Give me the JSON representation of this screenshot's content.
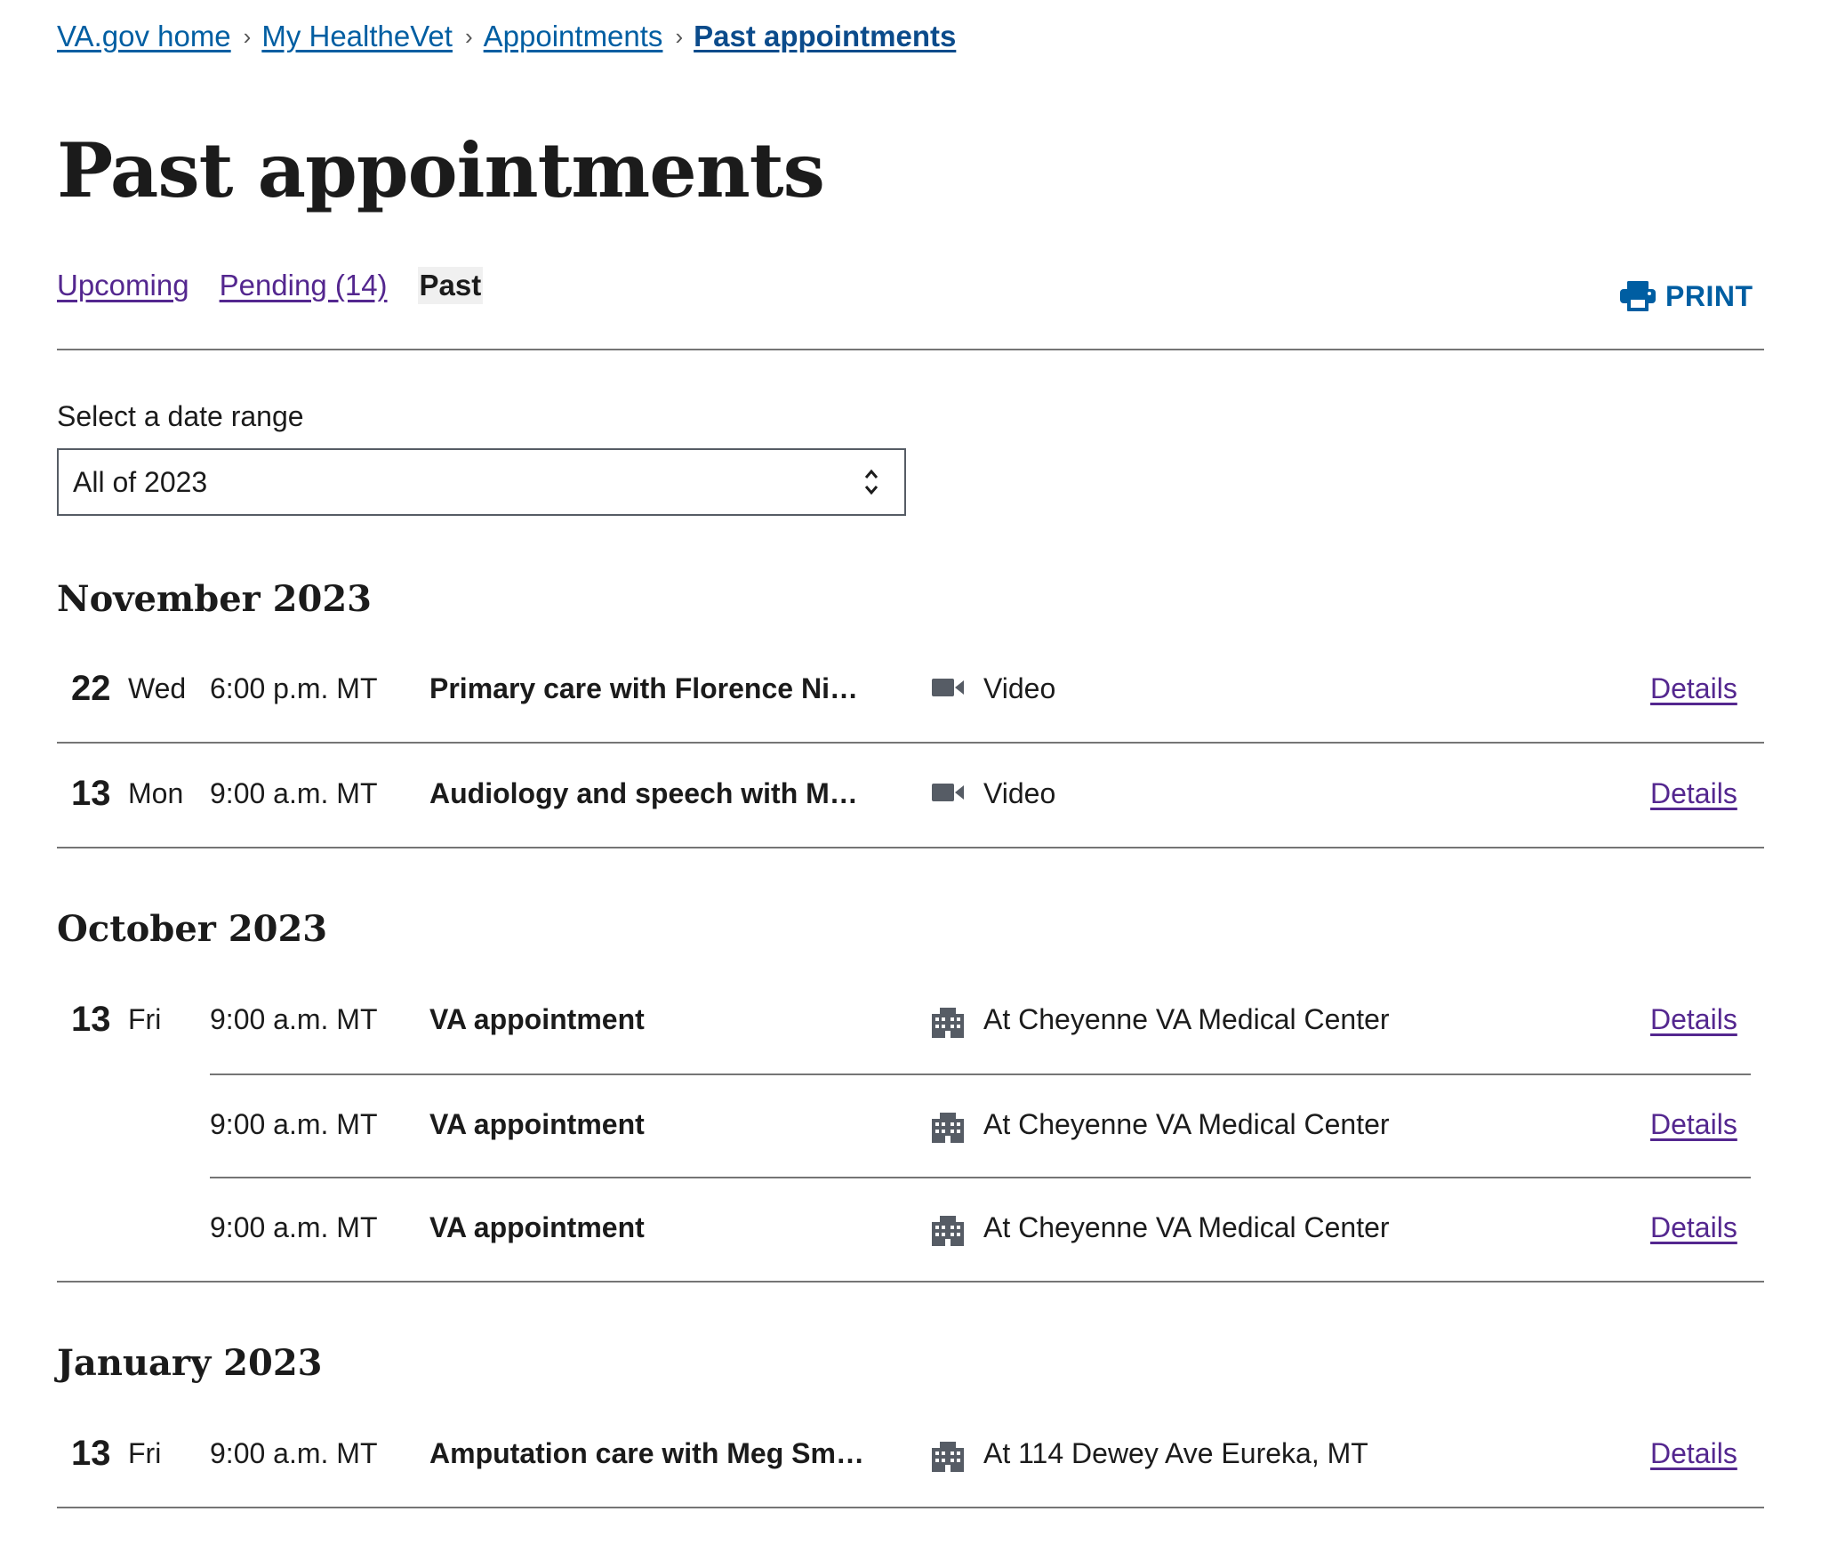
{
  "breadcrumb": {
    "items": [
      "VA.gov home",
      "My HealtheVet",
      "Appointments"
    ],
    "current": "Past appointments"
  },
  "page_title": "Past appointments",
  "tabs": {
    "upcoming": "Upcoming",
    "pending": "Pending (14)",
    "past": "Past"
  },
  "print_label": "PRINT",
  "date_range": {
    "label": "Select a date range",
    "selected": "All of 2023"
  },
  "months": [
    {
      "heading": "November 2023",
      "appointments": [
        {
          "day": "22",
          "weekday": "Wed",
          "time": "6:00 p.m. MT",
          "title": "Primary care with Florence Nig...",
          "icon": "video-camera-icon",
          "location": "Video",
          "details": "Details"
        },
        {
          "day": "13",
          "weekday": "Mon",
          "time": "9:00 a.m. MT",
          "title": "Audiology and speech with Meg...",
          "icon": "video-camera-icon",
          "location": "Video",
          "details": "Details"
        }
      ]
    },
    {
      "heading": "October 2023",
      "appointments": [
        {
          "day": "13",
          "weekday": "Fri",
          "time": "9:00 a.m. MT",
          "title": "VA appointment",
          "icon": "building-icon",
          "location": "At Cheyenne VA Medical Center",
          "details": "Details"
        },
        {
          "day": "",
          "weekday": "",
          "time": "9:00 a.m. MT",
          "title": "VA appointment",
          "icon": "building-icon",
          "location": "At Cheyenne VA Medical Center",
          "details": "Details"
        },
        {
          "day": "",
          "weekday": "",
          "time": "9:00 a.m. MT",
          "title": "VA appointment",
          "icon": "building-icon",
          "location": "At Cheyenne VA Medical Center",
          "details": "Details"
        }
      ]
    },
    {
      "heading": "January 2023",
      "appointments": [
        {
          "day": "13",
          "weekday": "Fri",
          "time": "9:00 a.m. MT",
          "title": "Amputation care with Meg Smith",
          "icon": "building-icon",
          "location": "At 114 Dewey Ave Eureka, MT",
          "details": "Details"
        }
      ]
    }
  ],
  "colors": {
    "link": "#005ea2",
    "visited_link": "#54278f",
    "text": "#1b1b1b",
    "rule": "#757575",
    "icon": "#565c65"
  }
}
